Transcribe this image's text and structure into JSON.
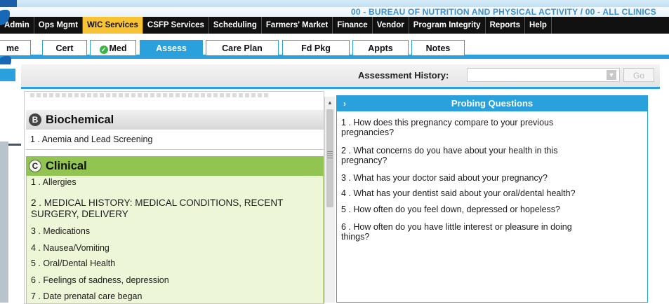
{
  "header": {
    "org_line": "00 - BUREAU OF NUTRITION AND PHYSICAL ACTIVITY / 00 - ALL CLINICS"
  },
  "main_nav": {
    "items": [
      {
        "label": "Admin"
      },
      {
        "label": "Ops Mgmt"
      },
      {
        "label": "WIC Services",
        "active": true
      },
      {
        "label": "CSFP Services"
      },
      {
        "label": "Scheduling"
      },
      {
        "label": "Farmers' Market"
      },
      {
        "label": "Finance"
      },
      {
        "label": "Vendor"
      },
      {
        "label": "Program Integrity"
      },
      {
        "label": "Reports"
      },
      {
        "label": "Help"
      }
    ]
  },
  "tabs": {
    "items": [
      {
        "label": "me"
      },
      {
        "label": "Cert"
      },
      {
        "label": "Med",
        "completed": true
      },
      {
        "label": "Assess",
        "active": true
      },
      {
        "label": "Care Plan"
      },
      {
        "label": "Fd Pkg"
      },
      {
        "label": "Appts"
      },
      {
        "label": "Notes"
      }
    ]
  },
  "history": {
    "label": "Assessment History:",
    "selected": "",
    "go_label": "Go"
  },
  "sections": {
    "biochemical": {
      "badge": "B",
      "title": "Biochemical",
      "items": [
        "1 . Anemia and Lead Screening"
      ]
    },
    "clinical": {
      "badge": "C",
      "title": "Clinical",
      "items": [
        "1 . Allergies",
        "2 . MEDICAL HISTORY: MEDICAL CONDITIONS, RECENT",
        "SURGERY, DELIVERY",
        "3 . Medications",
        "4 . Nausea/Vomiting",
        "5 . Oral/Dental Health",
        "6 . Feelings of sadness, depression",
        "7 . Date prenatal care began"
      ]
    }
  },
  "probing": {
    "toggle": "›",
    "title": "Probing Questions",
    "questions": [
      "1 . How does this pregnancy compare to your previous",
      "pregnancies?",
      "2 . What concerns do you have about your health in this",
      "pregnancy?",
      "3 . What has your doctor said about your pregnancy?",
      "4 . What has your dentist said about your oral/dental health?",
      "5 . How often do you feel down, depressed or hopeless?",
      "6 . How often do you have little interest or pleasure in doing",
      "things?"
    ]
  },
  "colors": {
    "accent_blue": "#2aa0dc",
    "nav_active": "#f7c234",
    "clinical_green": "#92c452",
    "clinical_bg": "#eef6d8"
  }
}
